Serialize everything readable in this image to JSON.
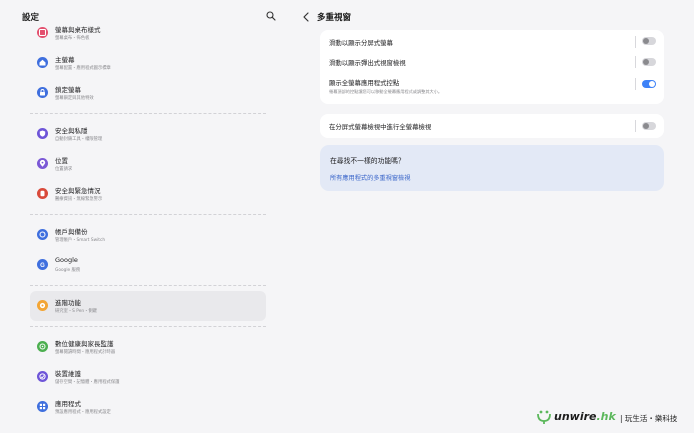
{
  "left": {
    "title": "設定",
    "items": [
      {
        "title": "螢幕與桌布樣式",
        "sub": "螢幕桌布・佈色板",
        "color": "#e3506f",
        "icon": "wallpaper-icon"
      },
      {
        "title": "主螢幕",
        "sub": "螢幕配置・應用程式圖示標章",
        "color": "#3f6fde",
        "icon": "home-icon"
      },
      {
        "title": "鎖定螢幕",
        "sub": "螢幕鎖定與其他特效",
        "color": "#3f6fde",
        "icon": "lock-icon"
      },
      {
        "sep": true
      },
      {
        "title": "安全與私隱",
        "sub": "自動封鎖工具・權限管理",
        "color": "#6e55d8",
        "icon": "shield-icon"
      },
      {
        "title": "位置",
        "sub": "位置請求",
        "color": "#7b58d6",
        "icon": "location-icon"
      },
      {
        "title": "安全與緊急情況",
        "sub": "醫療資訊・無線緊急警示",
        "color": "#d94a3b",
        "icon": "emergency-icon"
      },
      {
        "sep": true
      },
      {
        "title": "帳戶與備份",
        "sub": "管理帳戶・Smart Switch",
        "color": "#3f6fde",
        "icon": "sync-icon"
      },
      {
        "title": "Google",
        "sub": "Google 服務",
        "color": "#3f6fde",
        "icon": "google-icon"
      },
      {
        "sep": true
      },
      {
        "title": "進階功能",
        "sub": "研究室・S Pen・側鍵",
        "color": "#f3a534",
        "icon": "gear-plus-icon",
        "selected": true
      },
      {
        "sep": true
      },
      {
        "title": "數位健康與家長監護",
        "sub": "螢幕閱讀時間・應用程式計時器",
        "color": "#4caf50",
        "icon": "wellbeing-icon"
      },
      {
        "title": "裝置維護",
        "sub": "儲存空間・記憶體・應用程式保護",
        "color": "#6e55d8",
        "icon": "care-icon"
      },
      {
        "title": "應用程式",
        "sub": "預設應用程式・應用程式設定",
        "color": "#3f6fde",
        "icon": "apps-icon"
      }
    ]
  },
  "right": {
    "title": "多重視窗",
    "rows": [
      {
        "label": "滑動以顯示分屏式螢幕",
        "sub": "",
        "on": false
      },
      {
        "label": "滑動以顯示彈出式視窗檢視",
        "sub": "",
        "on": false
      },
      {
        "label": "顯示全螢幕應用程式控點",
        "sub": "螢幕頂部的控點讓您可以移動全螢幕應用程式或調整其大小。",
        "on": true
      }
    ],
    "row2": {
      "label": "在分屏式螢幕檢視中進行全螢幕檢視",
      "on": false
    },
    "hint_question": "在尋找不一樣的功能嗎？",
    "hint_link": "所有應用程式的多重視窗檢視"
  },
  "watermark": {
    "brand": "unwire",
    "suffix": ".hk",
    "slogan": "| 玩生活・樂科技"
  }
}
